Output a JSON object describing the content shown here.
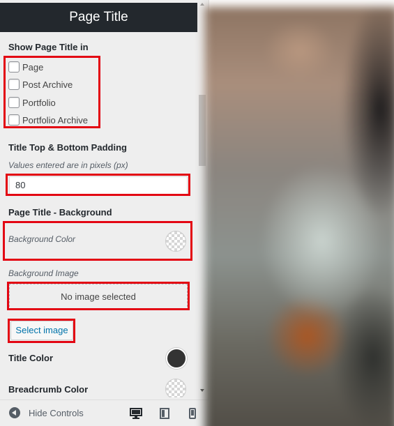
{
  "panel": {
    "title": "Page Title"
  },
  "show_title": {
    "heading": "Show Page Title in",
    "options": [
      {
        "label": "Page",
        "checked": false
      },
      {
        "label": "Post Archive",
        "checked": false
      },
      {
        "label": "Portfolio",
        "checked": false
      },
      {
        "label": "Portfolio Archive",
        "checked": false
      }
    ]
  },
  "padding": {
    "heading": "Title Top & Bottom Padding",
    "description": "Values entered are in pixels (px)",
    "value": "80"
  },
  "background": {
    "heading": "Page Title - Background",
    "color_label": "Background Color",
    "image_label": "Background Image",
    "image_placeholder": "No image selected",
    "select_button": "Select image"
  },
  "title_color": {
    "label": "Title Color",
    "value": "#333333"
  },
  "breadcrumb_color": {
    "label": "Breadcrumb Color"
  },
  "footer": {
    "hide_controls": "Hide Controls",
    "devices": [
      "desktop-icon",
      "tablet-icon",
      "mobile-icon"
    ]
  },
  "colors": {
    "header_bg": "#23282d",
    "highlight": "#e30613",
    "link": "#0073aa"
  }
}
